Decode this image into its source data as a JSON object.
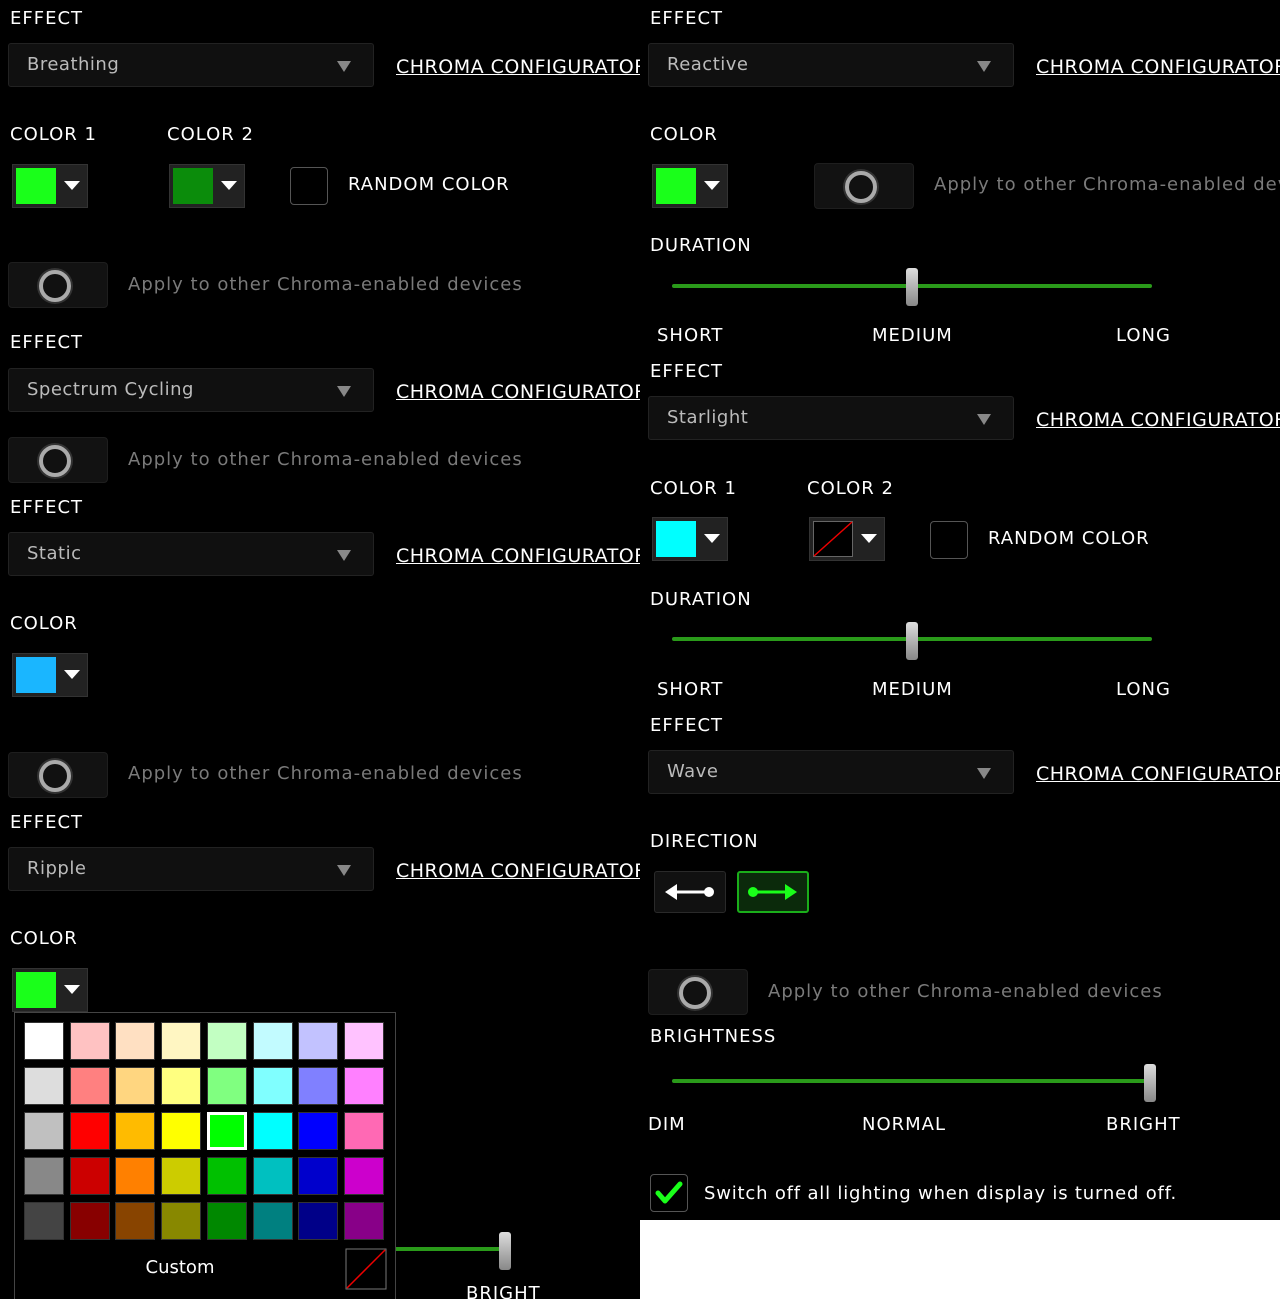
{
  "left": {
    "breathing": {
      "effect_label": "EFFECT",
      "effect_value": "Breathing",
      "config_link": "CHROMA CONFIGURATOR",
      "color1_label": "COLOR 1",
      "color2_label": "COLOR 2",
      "color1": "#1aff1a",
      "color2": "#0b8c0b",
      "random_label": "RANDOM COLOR",
      "apply_label": "Apply to other Chroma-enabled devices"
    },
    "spectrum": {
      "effect_label": "EFFECT",
      "effect_value": "Spectrum Cycling",
      "config_link": "CHROMA CONFIGURATOR",
      "apply_label": "Apply to other Chroma-enabled devices"
    },
    "static": {
      "effect_label": "EFFECT",
      "effect_value": "Static",
      "config_link": "CHROMA CONFIGURATOR",
      "color_label": "COLOR",
      "color": "#1ab6ff",
      "apply_label": "Apply to other Chroma-enabled devices"
    },
    "ripple": {
      "effect_label": "EFFECT",
      "effect_value": "Ripple",
      "config_link": "CHROMA CONFIGURATOR",
      "color_label": "COLOR",
      "color": "#1aff1a",
      "bright_label": "BRIGHT",
      "palette": {
        "rows": [
          [
            "#ffffff",
            "#ffc2c2",
            "#ffe0c2",
            "#fff6c2",
            "#c2ffc2",
            "#c2fbff",
            "#c2c2ff",
            "#ffc2ff"
          ],
          [
            "#dddddd",
            "#ff8080",
            "#ffd680",
            "#ffff80",
            "#80ff80",
            "#80ffff",
            "#8080ff",
            "#ff80ff"
          ],
          [
            "#c0c0c0",
            "#ff0000",
            "#ffbb00",
            "#ffff00",
            "#00ff00",
            "#00ffff",
            "#0000ff",
            "#ff69b4"
          ],
          [
            "#888888",
            "#cc0000",
            "#ff8000",
            "#cccc00",
            "#00c000",
            "#00c0c0",
            "#0000cc",
            "#cc00cc"
          ],
          [
            "#444444",
            "#880000",
            "#884400",
            "#888800",
            "#008800",
            "#008080",
            "#000088",
            "#880088"
          ]
        ],
        "selected_row": 2,
        "selected_col": 4,
        "custom_label": "Custom"
      }
    }
  },
  "right": {
    "reactive": {
      "effect_label": "EFFECT",
      "effect_value": "Reactive",
      "config_link": "CHROMA CONFIGURATOR",
      "color_label": "COLOR",
      "color": "#1aff1a",
      "apply_label": "Apply to other Chroma-enabled devices",
      "duration_label": "DURATION",
      "short_label": "SHORT",
      "medium_label": "MEDIUM",
      "long_label": "LONG",
      "duration_level": 0.5
    },
    "starlight": {
      "effect_label": "EFFECT",
      "effect_value": "Starlight",
      "config_link": "CHROMA CONFIGURATOR",
      "color1_label": "COLOR 1",
      "color2_label": "COLOR 2",
      "color1": "#00ffff",
      "random_label": "RANDOM COLOR",
      "duration_label": "DURATION",
      "short_label": "SHORT",
      "medium_label": "MEDIUM",
      "long_label": "LONG",
      "duration_level": 0.5
    },
    "wave": {
      "effect_label": "EFFECT",
      "effect_value": "Wave",
      "config_link": "CHROMA CONFIGURATOR",
      "direction_label": "DIRECTION",
      "apply_label": "Apply to other Chroma-enabled devices",
      "brightness_label": "BRIGHTNESS",
      "dim_label": "DIM",
      "normal_label": "NORMAL",
      "bright_label": "BRIGHT",
      "brightness_level": 1.0,
      "switch_off_label": "Switch off all lighting when display is turned off.",
      "switch_off_checked": true
    }
  },
  "colors": {
    "accent": "#2a9a1a",
    "background": "#000000"
  }
}
